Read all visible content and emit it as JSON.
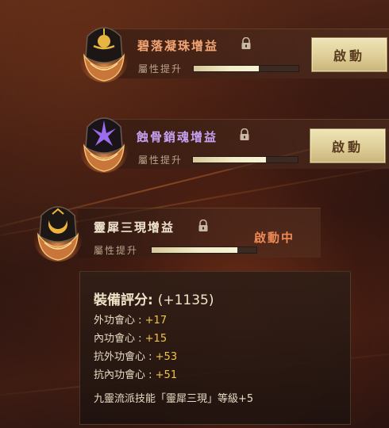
{
  "buffs": [
    {
      "name": "碧落凝珠增益",
      "attr_label": "屬性提升",
      "progress_white": 0.62,
      "progress_gold": 0.0,
      "button_label": "啟動",
      "state": "inactive",
      "gem_color": "#e6b640",
      "title_color": "#f2a472"
    },
    {
      "name": "蝕骨銷魂增益",
      "attr_label": "屬性提升",
      "progress_white": 0.7,
      "progress_gold": 0.0,
      "button_label": "啟動",
      "state": "inactive",
      "gem_color": "#9c6cf0",
      "title_color": "#c6a2f2"
    },
    {
      "name": "靈犀三現增益",
      "attr_label": "屬性提升",
      "progress_white": 0.82,
      "progress_gold": 0.0,
      "status_label": "啟動中",
      "state": "active",
      "gem_color": "#f0b43a",
      "title_color": "#f1e6cf"
    }
  ],
  "tooltip": {
    "score_label": "裝備評分:",
    "score_value": "(+1135)",
    "stats": [
      {
        "label": "外功會心 : ",
        "value": "+17"
      },
      {
        "label": "內功會心 : ",
        "value": "+15"
      },
      {
        "label": "抗外功會心 : ",
        "value": "+53"
      },
      {
        "label": "抗內功會心 : ",
        "value": "+51"
      }
    ],
    "skill_text": "九靈流派技能「靈犀三現」等級+5"
  },
  "icons": {
    "lock": "lock-icon",
    "gem1": "golden-crown-gem-icon",
    "gem2": "purple-claw-gem-icon",
    "gem3": "crescent-moon-gem-icon"
  }
}
